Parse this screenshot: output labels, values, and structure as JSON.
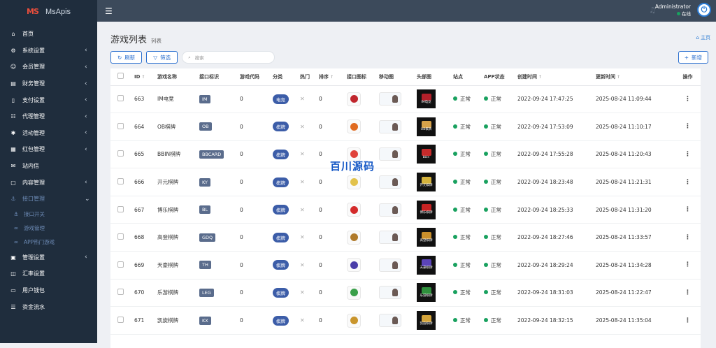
{
  "brand": {
    "logo_mark": "MS",
    "name": "MsApis"
  },
  "sidebar": {
    "items": [
      {
        "icon": "home-icon",
        "glyph": "⌂",
        "label": "首页",
        "chevron": ""
      },
      {
        "icon": "cogs-icon",
        "glyph": "⚙",
        "label": "系统设置",
        "chevron": "‹"
      },
      {
        "icon": "user-icon",
        "glyph": "☺",
        "label": "会员管理",
        "chevron": "‹"
      },
      {
        "icon": "finance-icon",
        "glyph": "▤",
        "label": "财务管理",
        "chevron": "‹"
      },
      {
        "icon": "bookmark-icon",
        "glyph": "▯",
        "label": "支付设置",
        "chevron": "‹"
      },
      {
        "icon": "agent-icon",
        "glyph": "☷",
        "label": "代理管理",
        "chevron": "‹"
      },
      {
        "icon": "activity-icon",
        "glyph": "✱",
        "label": "活动管理",
        "chevron": "‹"
      },
      {
        "icon": "gift-icon",
        "glyph": "▦",
        "label": "红包管理",
        "chevron": "‹"
      },
      {
        "icon": "mail-icon",
        "glyph": "✉",
        "label": "站内信",
        "chevron": ""
      },
      {
        "icon": "content-icon",
        "glyph": "▢",
        "label": "内容管理",
        "chevron": "‹"
      },
      {
        "icon": "anchor-icon",
        "glyph": "⚓",
        "label": "接口管理",
        "chevron": "⌄",
        "active": true
      }
    ],
    "sub_items": [
      {
        "icon": "anchor-icon",
        "glyph": "⚓",
        "label": "接口开关"
      },
      {
        "icon": "link-icon",
        "glyph": "∞",
        "label": "游戏管理"
      },
      {
        "icon": "link-icon",
        "glyph": "∞",
        "label": "APP热门游戏"
      }
    ],
    "items_after": [
      {
        "icon": "id-card-icon",
        "glyph": "▣",
        "label": "管理设置",
        "chevron": "‹"
      },
      {
        "icon": "rate-icon",
        "glyph": "◫",
        "label": "汇率设置",
        "chevron": ""
      },
      {
        "icon": "wallet-icon",
        "glyph": "▭",
        "label": "用户钱包",
        "chevron": ""
      },
      {
        "icon": "list-icon",
        "glyph": "☰",
        "label": "资金流水",
        "chevron": ""
      }
    ]
  },
  "topbar": {
    "user_name": "Administrator",
    "user_status": "在线"
  },
  "page": {
    "title": "游戏列表",
    "subtitle": "列表",
    "breadcrumb": "主页"
  },
  "toolbar": {
    "refresh_label": "刷新",
    "filter_label": "筛选",
    "search_placeholder": "搜索",
    "add_label": "新增"
  },
  "table": {
    "headers": [
      "ID",
      "游戏名称",
      "接口标识",
      "游戏代码",
      "分类",
      "热门",
      "排序",
      "接口图标",
      "移动图",
      "头部图",
      "站点",
      "APP状态",
      "创建时间",
      "更新时间",
      "操作"
    ],
    "rows": [
      {
        "id": "663",
        "name": "IM电竞",
        "code": "IM",
        "game_code": "0",
        "category": "电竞",
        "sort": "0",
        "site": "正常",
        "app": "正常",
        "created": "2022-09-24 17:47:25",
        "updated": "2025-08-24 11:09:44",
        "icon_color": "#c0262d",
        "head_text": "IM电竞",
        "head_color": "#b3202a"
      },
      {
        "id": "664",
        "name": "OB棋牌",
        "code": "OB",
        "game_code": "0",
        "category": "棋牌",
        "sort": "0",
        "site": "正常",
        "app": "正常",
        "created": "2022-09-24 17:53:09",
        "updated": "2025-08-24 11:10:17",
        "icon_color": "#e06a1f",
        "head_text": "OB棋牌",
        "head_color": "#d7a24a"
      },
      {
        "id": "665",
        "name": "BBIN棋牌",
        "code": "BBCARD",
        "game_code": "0",
        "category": "棋牌",
        "sort": "0",
        "site": "正常",
        "app": "正常",
        "created": "2022-09-24 17:55:28",
        "updated": "2025-08-24 11:20:43",
        "icon_color": "#e0423a",
        "head_text": "bbin",
        "head_color": "#c62b2b"
      },
      {
        "id": "666",
        "name": "开元棋牌",
        "code": "KY",
        "game_code": "0",
        "category": "棋牌",
        "sort": "0",
        "site": "正常",
        "app": "正常",
        "created": "2022-09-24 18:23:48",
        "updated": "2025-08-24 11:21:31",
        "icon_color": "#e2c24b",
        "head_text": "开元棋牌",
        "head_color": "#d4b23c"
      },
      {
        "id": "667",
        "name": "博乐棋牌",
        "code": "BL",
        "game_code": "0",
        "category": "棋牌",
        "sort": "0",
        "site": "正常",
        "app": "正常",
        "created": "2022-09-24 18:25:33",
        "updated": "2025-08-24 11:31:20",
        "icon_color": "#d42b2b",
        "head_text": "博乐棋牌",
        "head_color": "#c62323"
      },
      {
        "id": "668",
        "name": "高登棋牌",
        "code": "GDQ",
        "game_code": "0",
        "category": "棋牌",
        "sort": "0",
        "site": "正常",
        "app": "正常",
        "created": "2022-09-24 18:27:46",
        "updated": "2025-08-24 11:33:57",
        "icon_color": "#b07a2a",
        "head_text": "高登棋牌",
        "head_color": "#c98f2c"
      },
      {
        "id": "669",
        "name": "天豪棋牌",
        "code": "TH",
        "game_code": "0",
        "category": "棋牌",
        "sort": "0",
        "site": "正常",
        "app": "正常",
        "created": "2022-09-24 18:29:24",
        "updated": "2025-08-24 11:34:28",
        "icon_color": "#4a3da8",
        "head_text": "天豪棋牌",
        "head_color": "#5b44b8"
      },
      {
        "id": "670",
        "name": "乐游棋牌",
        "code": "LEG",
        "game_code": "0",
        "category": "棋牌",
        "sort": "0",
        "site": "正常",
        "app": "正常",
        "created": "2022-09-24 18:31:03",
        "updated": "2025-08-24 11:22:47",
        "icon_color": "#3aa04a",
        "head_text": "乐游棋牌",
        "head_color": "#2f8f3c"
      },
      {
        "id": "671",
        "name": "凯旋棋牌",
        "code": "KX",
        "game_code": "0",
        "category": "棋牌",
        "sort": "0",
        "site": "正常",
        "app": "正常",
        "created": "2022-09-24 18:32:15",
        "updated": "2025-08-24 11:35:04",
        "icon_color": "#c9952c",
        "head_text": "凯旋棋牌",
        "head_color": "#d4a43a"
      }
    ]
  },
  "watermark": "百川源码",
  "colors": {
    "sidebar_bg": "#1f2d3d",
    "topbar_bg": "#3c4a5b",
    "accent": "#2a6fcf",
    "status_green": "#19a15f"
  }
}
